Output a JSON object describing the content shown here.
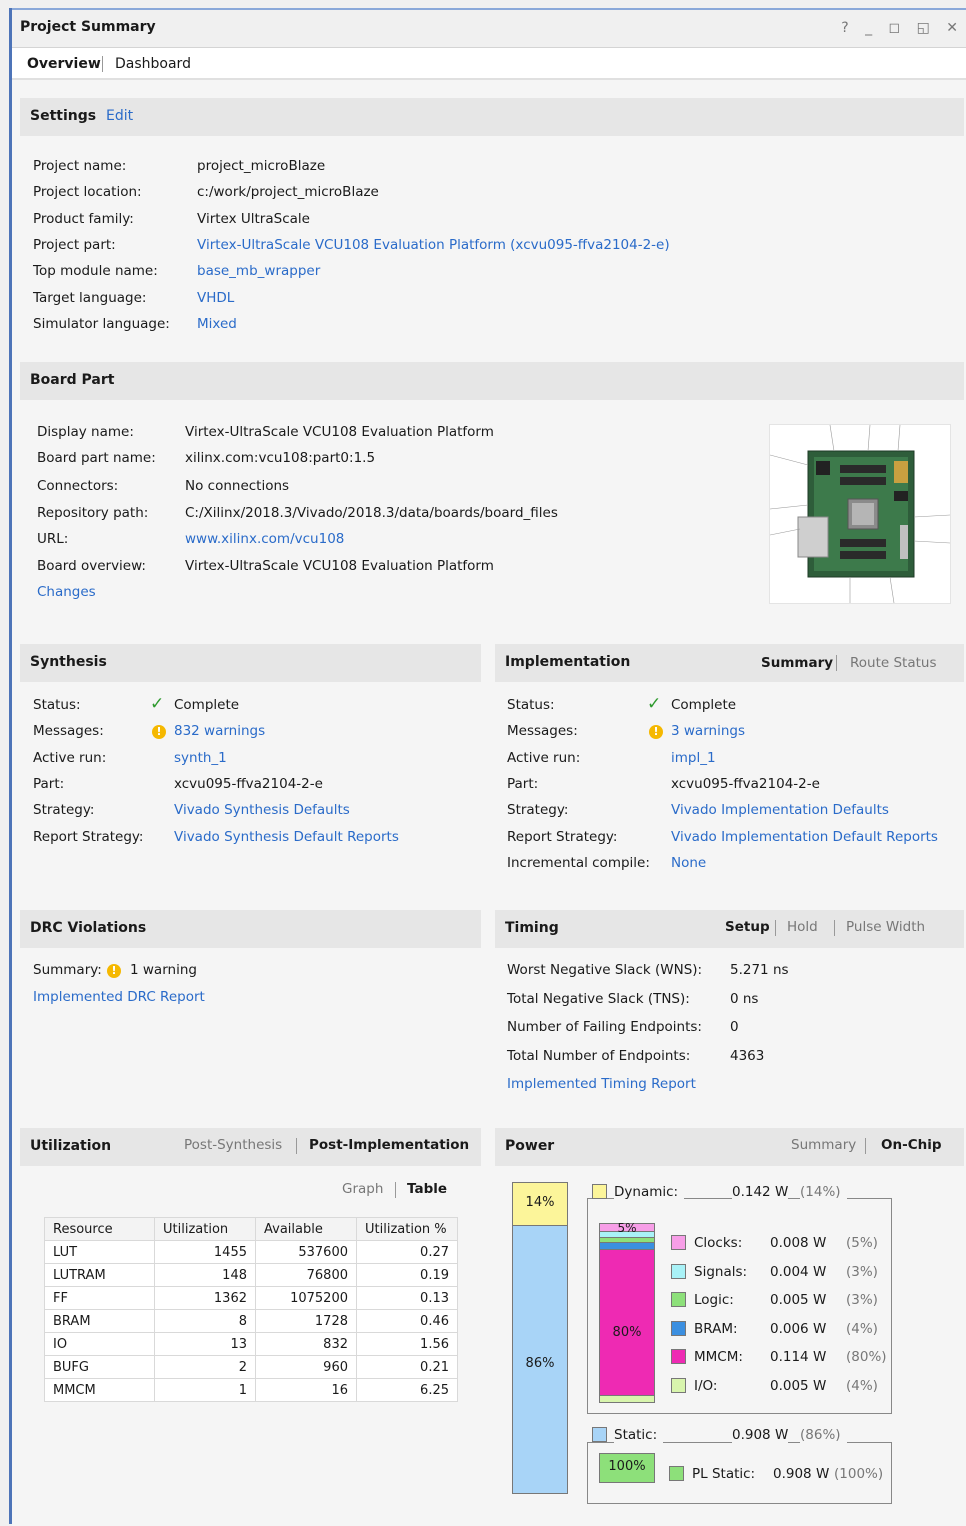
{
  "window": {
    "title": "Project Summary",
    "controls": "? _ ◻ ◱ ✕"
  },
  "tabs": [
    {
      "label": "Overview"
    },
    {
      "label": "Dashboard"
    }
  ],
  "settings": {
    "title": "Settings",
    "edit": "Edit",
    "rows": [
      {
        "label": "Project name:",
        "value": "project_microBlaze"
      },
      {
        "label": "Project location:",
        "value": "c:/work/project_microBlaze"
      },
      {
        "label": "Product family:",
        "value": "Virtex UltraScale"
      },
      {
        "label": "Project part:",
        "value": "Virtex-UltraScale VCU108 Evaluation Platform (xcvu095-ffva2104-2-e)"
      },
      {
        "label": "Top module name:",
        "value": "base_mb_wrapper"
      },
      {
        "label": "Target language:",
        "value": "VHDL"
      },
      {
        "label": "Simulator language:",
        "value": "Mixed"
      }
    ]
  },
  "board": {
    "title": "Board Part",
    "rows": [
      {
        "label": "Display name:",
        "value": "Virtex-UltraScale VCU108 Evaluation Platform"
      },
      {
        "label": "Board part name:",
        "value": "xilinx.com:vcu108:part0:1.5"
      },
      {
        "label": "Connectors:",
        "value": "No connections"
      },
      {
        "label": "Repository path:",
        "value": "C:/Xilinx/2018.3/Vivado/2018.3/data/boards/board_files"
      },
      {
        "label": "URL:",
        "value": "www.xilinx.com/vcu108"
      },
      {
        "label": "Board overview:",
        "value": "Virtex-UltraScale VCU108 Evaluation Platform"
      }
    ],
    "changes": "Changes"
  },
  "synthesis": {
    "title": "Synthesis",
    "rows": [
      {
        "label": "Status:",
        "value": "Complete"
      },
      {
        "label": "Messages:",
        "value": "832 warnings"
      },
      {
        "label": "Active run:",
        "value": "synth_1"
      },
      {
        "label": "Part:",
        "value": "xcvu095-ffva2104-2-e"
      },
      {
        "label": "Strategy:",
        "value": "Vivado Synthesis Defaults"
      },
      {
        "label": "Report Strategy:",
        "value": "Vivado Synthesis Default Reports"
      }
    ]
  },
  "implementation": {
    "title": "Implementation",
    "tab_summary": "Summary",
    "tab_route": "Route Status",
    "rows": [
      {
        "label": "Status:",
        "value": "Complete"
      },
      {
        "label": "Messages:",
        "value": "3 warnings"
      },
      {
        "label": "Active run:",
        "value": "impl_1"
      },
      {
        "label": "Part:",
        "value": "xcvu095-ffva2104-2-e"
      },
      {
        "label": "Strategy:",
        "value": "Vivado Implementation Defaults"
      },
      {
        "label": "Report Strategy:",
        "value": "Vivado Implementation Default Reports"
      },
      {
        "label": "Incremental compile:",
        "value": "None"
      }
    ]
  },
  "drc": {
    "title": "DRC Violations",
    "summary_label": "Summary:",
    "summary_value": "1 warning",
    "report": "Implemented DRC Report"
  },
  "timing": {
    "title": "Timing",
    "tab_setup": "Setup",
    "tab_hold": "Hold",
    "tab_pulse": "Pulse Width",
    "rows": [
      {
        "label": "Worst Negative Slack (WNS):",
        "value": "5.271 ns"
      },
      {
        "label": "Total Negative Slack (TNS):",
        "value": "0 ns"
      },
      {
        "label": "Number of Failing Endpoints:",
        "value": "0"
      },
      {
        "label": "Total Number of Endpoints:",
        "value": "4363"
      }
    ],
    "report": "Implemented Timing Report"
  },
  "utilization": {
    "title": "Utilization",
    "tab_post_synth": "Post-Synthesis",
    "tab_post_impl": "Post-Implementation",
    "view_graph": "Graph",
    "view_table": "Table",
    "headers": [
      "Resource",
      "Utilization",
      "Available",
      "Utilization %"
    ],
    "rows": [
      [
        "LUT",
        "1455",
        "537600",
        "0.27"
      ],
      [
        "LUTRAM",
        "148",
        "76800",
        "0.19"
      ],
      [
        "FF",
        "1362",
        "1075200",
        "0.13"
      ],
      [
        "BRAM",
        "8",
        "1728",
        "0.46"
      ],
      [
        "IO",
        "13",
        "832",
        "1.56"
      ],
      [
        "BUFG",
        "2",
        "960",
        "0.21"
      ],
      [
        "MMCM",
        "1",
        "16",
        "6.25"
      ]
    ]
  },
  "power": {
    "title": "Power",
    "tab_summary": "Summary",
    "tab_onchip": "On-Chip",
    "bar_dynamic_label": "14%",
    "bar_static_label": "86%",
    "dynamic": {
      "label": "Dynamic:",
      "value": "0.142 W",
      "pct": "(14%)",
      "fraction": 0.14
    },
    "static": {
      "label": "Static:",
      "value": "0.908 W",
      "pct": "(86%)",
      "fraction": 0.86
    },
    "dyn_bar_top_label": "5%",
    "dyn_bar_mid_label": "80%",
    "breakdown": [
      {
        "label": "Clocks:",
        "value": "0.008 W",
        "pct": "(5%)",
        "color": "#f79ee7",
        "fraction": 0.05
      },
      {
        "label": "Signals:",
        "value": "0.004 W",
        "pct": "(3%)",
        "color": "#a9f2f7",
        "fraction": 0.03
      },
      {
        "label": "Logic:",
        "value": "0.005 W",
        "pct": "(3%)",
        "color": "#8de07a",
        "fraction": 0.03
      },
      {
        "label": "BRAM:",
        "value": "0.006 W",
        "pct": "(4%)",
        "color": "#3b8fe0",
        "fraction": 0.04
      },
      {
        "label": "MMCM:",
        "value": "0.114 W",
        "pct": "(80%)",
        "color": "#ee2ab3",
        "fraction": 0.8
      },
      {
        "label": "I/O:",
        "value": "0.005 W",
        "pct": "(4%)",
        "color": "#d8f5ad",
        "fraction": 0.04
      }
    ],
    "pl_static": {
      "label": "PL Static:",
      "value": "0.908 W",
      "pct": "(100%)",
      "bar_label": "100%"
    },
    "colors": {
      "dynamic": "#fcf59a",
      "static": "#a8d4f7",
      "pl_static": "#8de07a"
    }
  }
}
